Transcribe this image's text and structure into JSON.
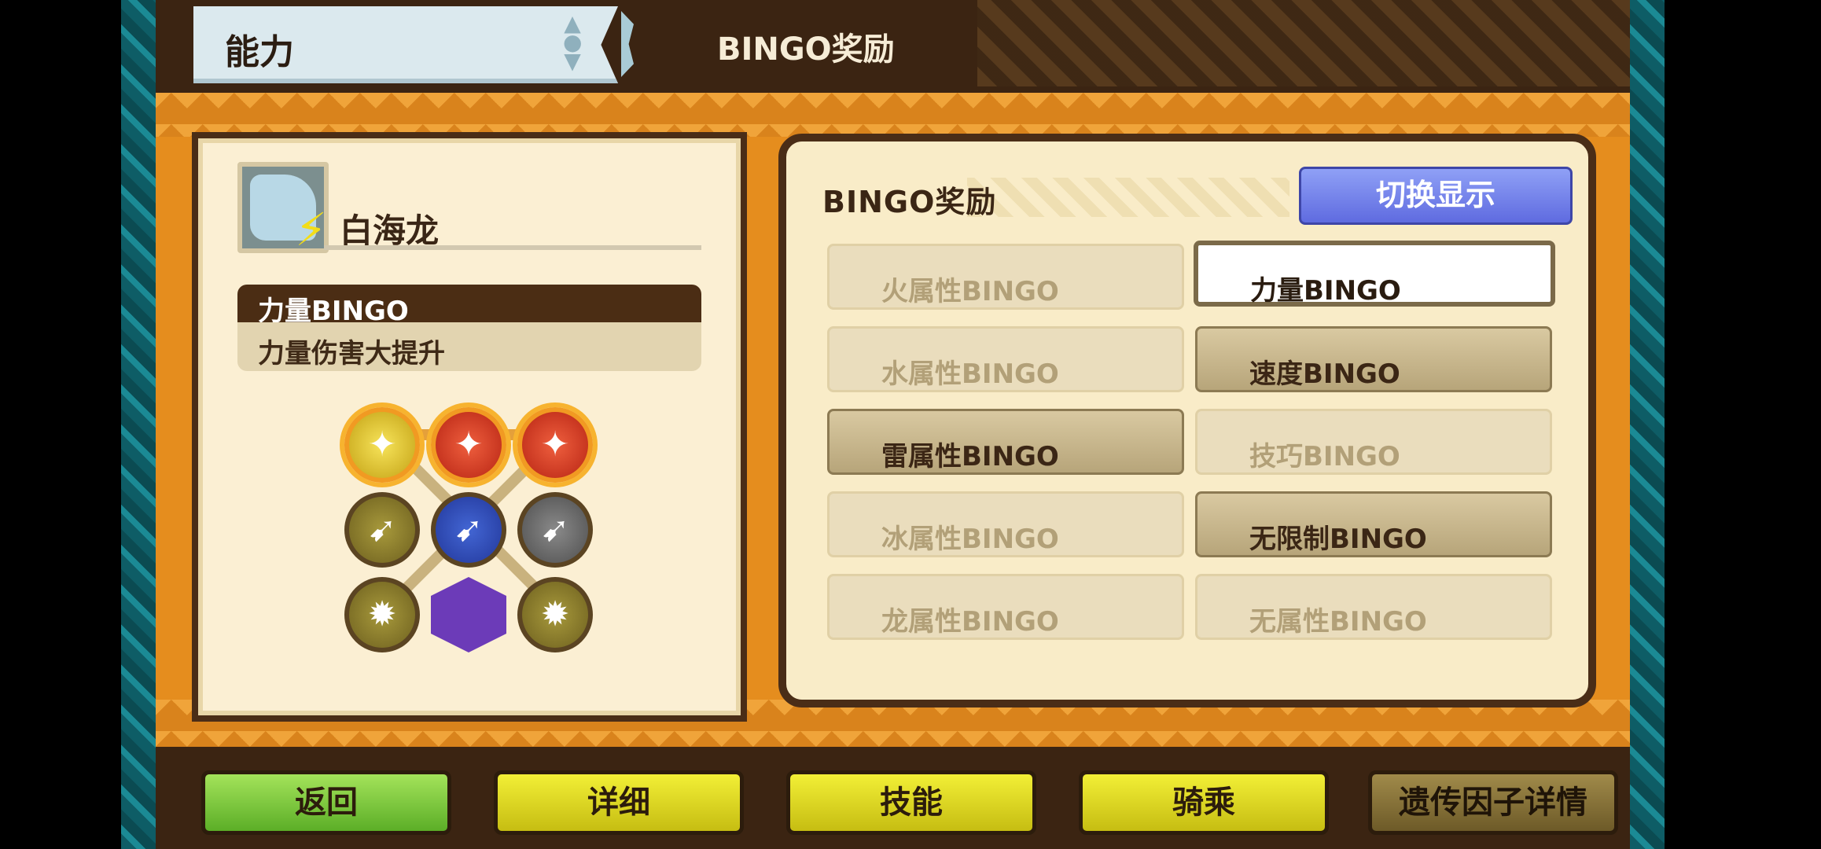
{
  "header": {
    "tab_title": "能力",
    "section_label": "BINGO奖励"
  },
  "monster": {
    "name": "白海龙"
  },
  "bingo": {
    "title": "力量BINGO",
    "description": "力量伤害大提升"
  },
  "grid_icons": [
    {
      "icon": "power-icon",
      "color": "#f3d733"
    },
    {
      "icon": "power-icon",
      "color": "#e24a2a"
    },
    {
      "icon": "power-icon",
      "color": "#e24a2a"
    },
    {
      "icon": "run-icon",
      "color": "#8f8033"
    },
    {
      "icon": "run-icon",
      "color": "#2d49c0"
    },
    {
      "icon": "run-icon",
      "color": "#6a6a6a"
    },
    {
      "icon": "burst-icon",
      "color": "#8f8033"
    },
    {
      "icon": "hexagon-icon",
      "color": "#6c3bb8"
    },
    {
      "icon": "burst-icon",
      "color": "#8f8033"
    }
  ],
  "rewards": {
    "title": "BINGO奖励",
    "switch_label": "切换显示",
    "left_options": [
      {
        "label": "火属性BINGO",
        "state": "off"
      },
      {
        "label": "水属性BINGO",
        "state": "off"
      },
      {
        "label": "雷属性BINGO",
        "state": "on"
      },
      {
        "label": "冰属性BINGO",
        "state": "off"
      },
      {
        "label": "龙属性BINGO",
        "state": "off"
      }
    ],
    "right_options": [
      {
        "label": "力量BINGO",
        "state": "selected"
      },
      {
        "label": "速度BINGO",
        "state": "on"
      },
      {
        "label": "技巧BINGO",
        "state": "off"
      },
      {
        "label": "无限制BINGO",
        "state": "on"
      },
      {
        "label": "无属性BINGO",
        "state": "off"
      }
    ]
  },
  "bottom_buttons": {
    "back": "返回",
    "detail": "详细",
    "skill": "技能",
    "ride": "骑乘",
    "gene_detail": "遗传因子详情"
  }
}
